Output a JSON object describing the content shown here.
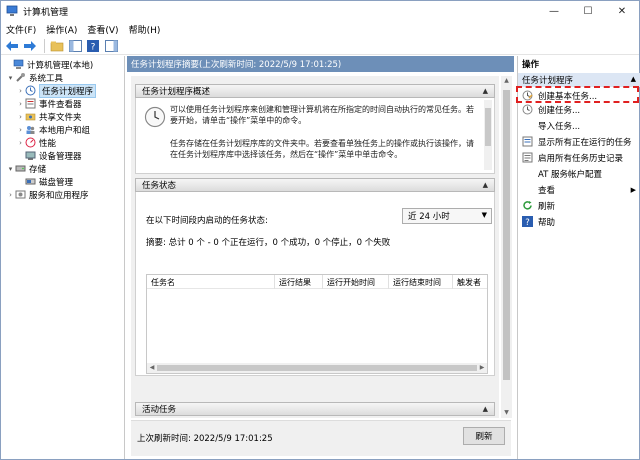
{
  "window": {
    "title": "计算机管理"
  },
  "menubar": {
    "items": [
      "文件(F)",
      "操作(A)",
      "查看(V)",
      "帮助(H)"
    ]
  },
  "tree": {
    "items": [
      {
        "label": "计算机管理(本地)",
        "level": 0,
        "arrow": "",
        "icon": "computer-icon"
      },
      {
        "label": "系统工具",
        "level": 1,
        "arrow": "▾",
        "icon": "tools-icon"
      },
      {
        "label": "任务计划程序",
        "level": 2,
        "arrow": "›",
        "icon": "clock-icon",
        "selected": true
      },
      {
        "label": "事件查看器",
        "level": 2,
        "arrow": "›",
        "icon": "event-viewer-icon"
      },
      {
        "label": "共享文件夹",
        "level": 2,
        "arrow": "›",
        "icon": "shared-folder-icon"
      },
      {
        "label": "本地用户和组",
        "level": 2,
        "arrow": "›",
        "icon": "users-icon"
      },
      {
        "label": "性能",
        "level": 2,
        "arrow": "›",
        "icon": "performance-icon"
      },
      {
        "label": "设备管理器",
        "level": 2,
        "arrow": "",
        "icon": "device-manager-icon"
      },
      {
        "label": "存储",
        "level": 1,
        "arrow": "▾",
        "icon": "storage-icon"
      },
      {
        "label": "磁盘管理",
        "level": 2,
        "arrow": "",
        "icon": "disk-icon"
      },
      {
        "label": "服务和应用程序",
        "level": 1,
        "arrow": "›",
        "icon": "services-icon"
      }
    ]
  },
  "middle": {
    "header": "任务计划程序摘要(上次刷新时间: 2022/5/9 17:01:25)",
    "overview": {
      "title": "任务计划程序概述",
      "para1": "可以使用任务计划程序来创建和管理计算机将在所指定的时间自动执行的常见任务。若要开始，请单击“操作”菜单中的命令。",
      "para2": "任务存储在任务计划程序库的文件夹中。若要查看单独任务上的操作或执行该操作，请在任务计划程序库中选择该任务，然后在“操作”菜单中单击命令。"
    },
    "status": {
      "title": "任务状态",
      "label": "在以下时间段内启动的任务状态:",
      "select_value": "近 24 小时",
      "summary": "摘要: 总计 0 个 - 0 个正在运行，0 个成功，0 个停止，0 个失败",
      "columns": [
        "任务名",
        "运行结果",
        "运行开始时间",
        "运行结束时间",
        "触发者"
      ]
    },
    "active": {
      "title": "活动任务"
    },
    "bottom": {
      "last_refresh": "上次刷新时间: 2022/5/9 17:01:25",
      "refresh_label": "刷新"
    }
  },
  "actions": {
    "title": "操作",
    "group": "任务计划程序",
    "items": [
      {
        "label": "创建基本任务...",
        "icon": "create-basic-task-icon"
      },
      {
        "label": "创建任务...",
        "icon": "create-task-icon"
      },
      {
        "label": "导入任务...",
        "icon": ""
      },
      {
        "label": "显示所有正在运行的任务",
        "icon": "running-tasks-icon"
      },
      {
        "label": "启用所有任务历史记录",
        "icon": "history-icon"
      },
      {
        "label": "AT 服务帐户配置",
        "icon": ""
      },
      {
        "label": "查看",
        "icon": "",
        "submenu": true
      },
      {
        "label": "刷新",
        "icon": "refresh-icon"
      },
      {
        "label": "帮助",
        "icon": "help-icon"
      }
    ]
  }
}
